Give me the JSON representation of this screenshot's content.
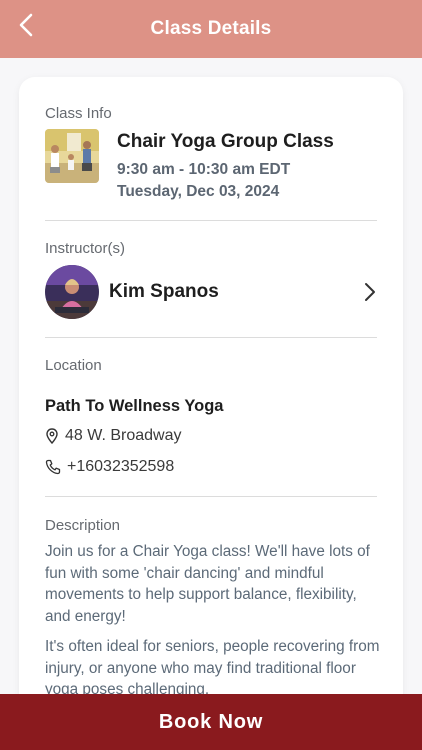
{
  "header": {
    "title": "Class Details",
    "back_icon": "chevron-left-icon",
    "color": "#dd9286"
  },
  "class_info": {
    "label": "Class Info",
    "name": "Chair Yoga Group Class",
    "time": "9:30 am - 10:30 am EDT",
    "date": "Tuesday, Dec 03, 2024"
  },
  "instructor": {
    "label": "Instructor(s)",
    "name": "Kim Spanos"
  },
  "location": {
    "label": "Location",
    "studio": "Path To Wellness Yoga",
    "address": "48 W. Broadway",
    "phone": "+16032352598"
  },
  "description": {
    "label": "Description",
    "paragraph_1": "Join us for a Chair Yoga class! We'll have lots of fun with some 'chair dancing' and mindful movements to help support balance, flexibility, and energy!",
    "paragraph_2": "It's often ideal for seniors, people recovering from injury, or anyone who may find traditional floor yoga poses challenging."
  },
  "cta": {
    "label": "Book Now",
    "color": "#8a1a1e"
  }
}
